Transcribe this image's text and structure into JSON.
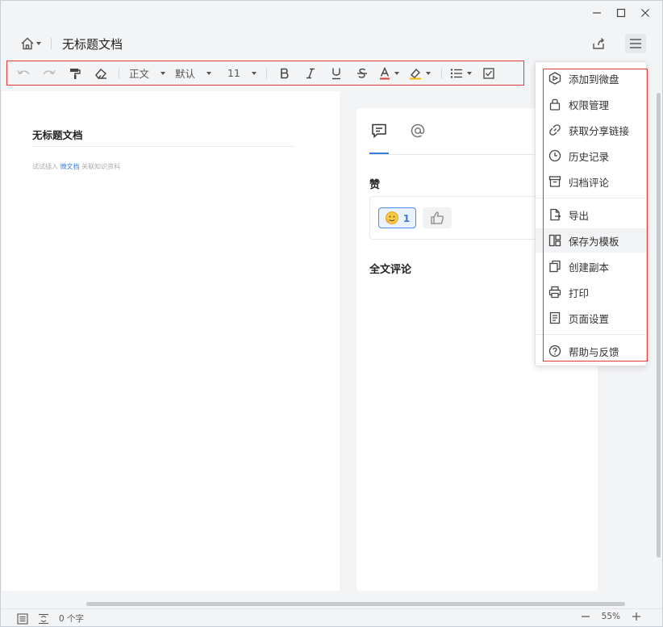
{
  "header": {
    "title": "无标题文档"
  },
  "toolbar": {
    "style_select": "正文",
    "font_select": "默认",
    "size_select": "11"
  },
  "page": {
    "title": "无标题文档",
    "hint_prefix": "试试插入",
    "hint_link": "微文档",
    "hint_suffix": "关联知识资料"
  },
  "panel": {
    "likes_heading": "赞",
    "like_count": "1",
    "comments_heading": "全文评论"
  },
  "menu": {
    "items": [
      {
        "label": "添加到微盘"
      },
      {
        "label": "权限管理"
      },
      {
        "label": "获取分享链接"
      },
      {
        "label": "历史记录"
      },
      {
        "label": "归档评论"
      },
      {
        "label": "导出"
      },
      {
        "label": "保存为模板"
      },
      {
        "label": "创建副本"
      },
      {
        "label": "打印"
      },
      {
        "label": "页面设置"
      },
      {
        "label": "帮助与反馈"
      }
    ]
  },
  "status": {
    "word_count": "0 个字",
    "zoom": "55%"
  },
  "colors": {
    "accent": "#3a7de0",
    "highlight_border": "#e53935"
  }
}
